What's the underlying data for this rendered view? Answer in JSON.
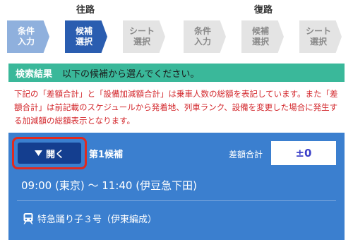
{
  "header": {
    "outbound_label": "往路",
    "return_label": "復路",
    "steps": [
      {
        "label": "条件\n入力",
        "state": "done"
      },
      {
        "label": "候補\n選択",
        "state": "current"
      },
      {
        "label": "シート\n選択",
        "state": "future"
      },
      {
        "label": "条件\n入力",
        "state": "future"
      },
      {
        "label": "候補\n選択",
        "state": "future"
      },
      {
        "label": "シート\n選択",
        "state": "future"
      }
    ]
  },
  "results": {
    "title": "検索結果",
    "instruction": "以下の候補から選んでください。"
  },
  "notice": "下記の「差額合計」と「設備加減額合計」は乗車人数の総額を表記しています。また「差額合計」は前記載のスケジュールから発着地、列車ランク、設備を変更した場合に発生する加減額の総額表示となります。",
  "candidate": {
    "open_label": "開く",
    "toggle_icon": "triangle-down-icon",
    "label": "第1候補",
    "diff_label": "差額合計",
    "diff_value": "±0",
    "route": "09:00 (東京) ～ 11:40 (伊豆急下田)",
    "train_icon": "train-icon",
    "train_name": "特急踊り子３号（伊東編成）"
  },
  "colors": {
    "accent": "#2a5db0",
    "card": "#3b7fcf",
    "banner": "#3ab89a",
    "notice": "#d3282d",
    "highlight": "#e02a1f"
  }
}
